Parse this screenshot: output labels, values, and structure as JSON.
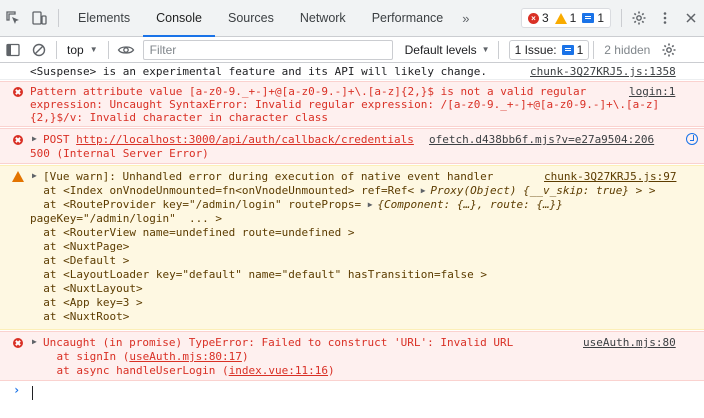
{
  "tabbar": {
    "tabs": [
      {
        "label": "Elements",
        "active": false
      },
      {
        "label": "Console",
        "active": true
      },
      {
        "label": "Sources",
        "active": false
      },
      {
        "label": "Network",
        "active": false
      },
      {
        "label": "Performance",
        "active": false
      }
    ],
    "more_label": "»",
    "counts": {
      "errors": "3",
      "warnings": "1",
      "info": "1"
    }
  },
  "toolbar": {
    "context": "top",
    "filter_placeholder": "Filter",
    "levels": "Default levels",
    "issues": "1 Issue:",
    "issues_count": "1",
    "hidden": "2 hidden"
  },
  "messages": [
    {
      "level": "log",
      "text": "<Suspense> is an experimental feature and its API will likely change.",
      "source": "chunk-3Q27KRJ5.js:1358"
    },
    {
      "level": "error",
      "lines": [
        "Pattern attribute value [a-z0-9._+-]+@[a-z0-9.-]+\\.[a-z]{2,}$ is not a valid regular",
        "expression: Uncaught SyntaxError: Invalid regular expression: /[a-z0-9._+-]+@[a-z0-9.-]+\\.[a-z]",
        "{2,}$/v: Invalid character in character class"
      ],
      "source": "login:1"
    },
    {
      "level": "error",
      "method": "POST",
      "url": "http://localhost:3000/api/auth/callback/credentials",
      "status": "500 (Internal Server Error)",
      "source": "ofetch.d438bb6f.mjs?v=e27a9504:206"
    },
    {
      "level": "warning",
      "lines": [
        "[Vue warn]: Unhandled error during execution of native event handler",
        "  at <Index onVnodeUnmounted=fn<onVnodeUnmounted> ref=Ref< ",
        "  at <RouteProvider key=\"/admin/login\" routeProps= ",
        "pageKey=\"/admin/login\"  ... >",
        "  at <RouterView name=undefined route=undefined >",
        "  at <NuxtPage>",
        "  at <Default >",
        "  at <LayoutLoader key=\"default\" name=\"default\" hasTransition=false >",
        "  at <NuxtLayout>",
        "  at <App key=3 >",
        "  at <NuxtRoot>"
      ],
      "proxy_text": "Proxy(Object) {__v_skip: true} > >",
      "props_text": "{Component: {…}, route: {…}}",
      "source": "chunk-3Q27KRJ5.js:97"
    },
    {
      "level": "error",
      "text": "Uncaught (in promise) TypeError: Failed to construct 'URL': Invalid URL",
      "stack": [
        {
          "prefix": "    at signIn (",
          "link": "useAuth.mjs:80:17",
          "suffix": ")"
        },
        {
          "prefix": "    at async handleUserLogin (",
          "link": "index.vue:11:16",
          "suffix": ")"
        }
      ],
      "source": "useAuth.mjs:80"
    }
  ]
}
